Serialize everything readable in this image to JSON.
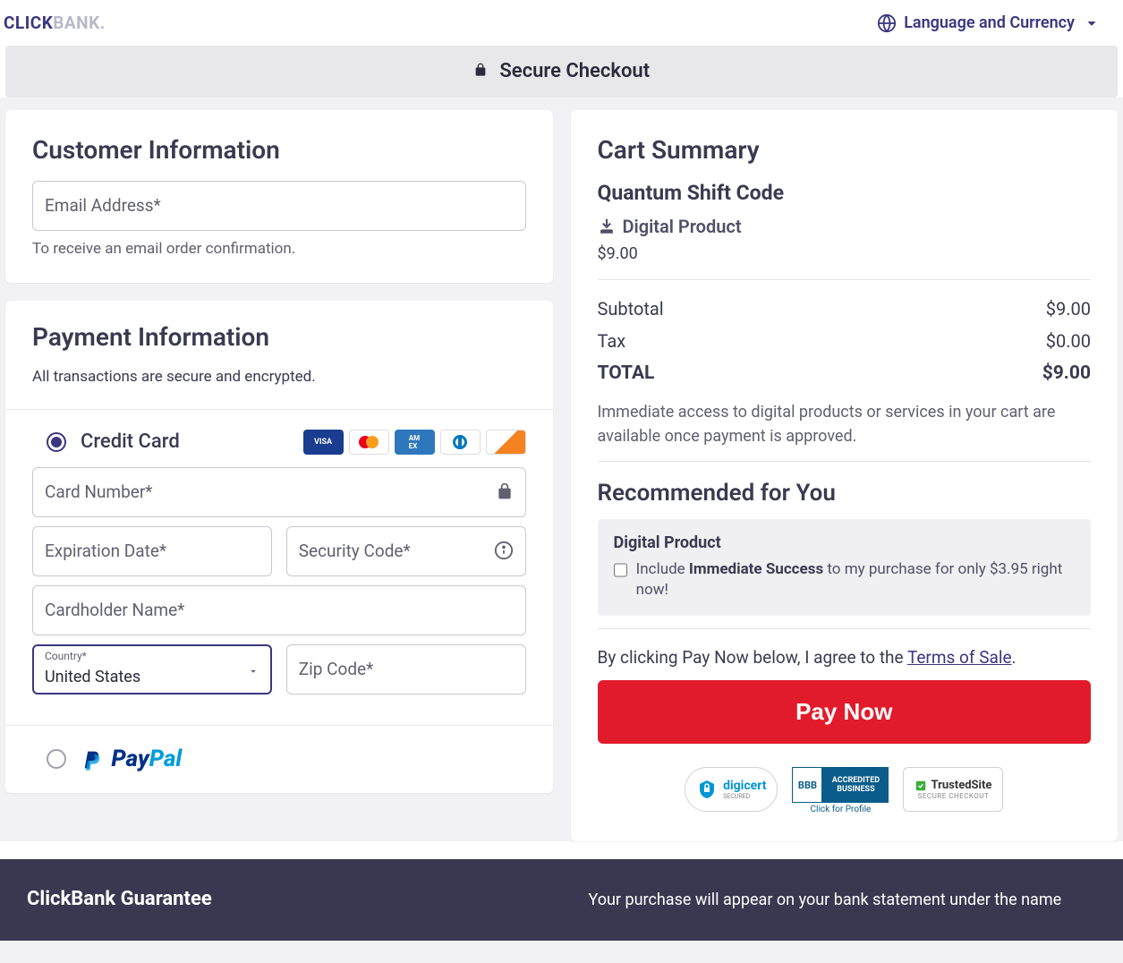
{
  "header": {
    "logo_part1": "CLICK",
    "logo_part2": "BANK",
    "lang_label": "Language and Currency"
  },
  "secure_bar": "Secure Checkout",
  "customer": {
    "title": "Customer Information",
    "email_label": "Email Address*",
    "email_help": "To receive an email order confirmation."
  },
  "payment": {
    "title": "Payment Information",
    "subtitle": "All transactions are secure and encrypted.",
    "credit_card_label": "Credit Card",
    "card_number_label": "Card Number*",
    "expiration_label": "Expiration Date*",
    "security_label": "Security Code*",
    "cardholder_label": "Cardholder Name*",
    "country_label": "Country*",
    "country_value": "United States",
    "zip_label": "Zip Code*",
    "paypal_pay": "Pay",
    "paypal_pal": "Pal"
  },
  "cart": {
    "title": "Cart Summary",
    "product_name": "Quantum Shift Code",
    "product_type": "Digital Product",
    "price": "$9.00",
    "subtotal_label": "Subtotal",
    "subtotal_value": "$9.00",
    "tax_label": "Tax",
    "tax_value": "$0.00",
    "total_label": "TOTAL",
    "total_value": "$9.00",
    "note": "Immediate access to digital products or services in your cart are available once payment is approved."
  },
  "recommended": {
    "title": "Recommended for You",
    "product_type": "Digital Product",
    "prefix": "Include ",
    "bold": "Immediate Success",
    "suffix": " to my purchase for only $3.95 right now!"
  },
  "terms": {
    "prefix": "By clicking Pay Now below, I agree to the ",
    "link": "Terms of Sale",
    "suffix": "."
  },
  "pay_now": "Pay Now",
  "badges": {
    "digicert": "digicert",
    "digicert_sub": "SECURED",
    "bbb_top": "ACCREDITED",
    "bbb_bottom": "BUSINESS",
    "bbb_sub": "Click for Profile",
    "trusted": "TrustedSite",
    "trusted_sub": "SECURE CHECKOUT"
  },
  "footer": {
    "guarantee_title": "ClickBank Guarantee",
    "statement_text": "Your purchase will appear on your bank statement under the name"
  }
}
